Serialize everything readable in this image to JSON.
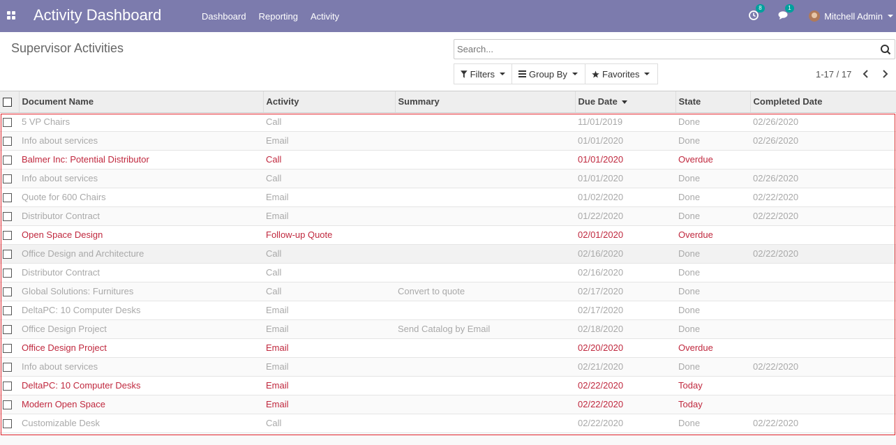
{
  "navbar": {
    "app_title": "Activity Dashboard",
    "menu": [
      "Dashboard",
      "Reporting",
      "Activity"
    ],
    "activity_count": "8",
    "message_count": "1",
    "user_name": "Mitchell Admin",
    "bg_color": "#7c7bad"
  },
  "control": {
    "page_title": "Supervisor Activities",
    "search_placeholder": "Search...",
    "filters_label": "Filters",
    "group_by_label": "Group By",
    "favorites_label": "Favorites",
    "pager_value": "1-17 / 17"
  },
  "table": {
    "headers": [
      "Document Name",
      "Activity",
      "Summary",
      "Due Date",
      "State",
      "Completed Date"
    ],
    "sorted_column": "Due Date",
    "rows": [
      {
        "doc": "5 VP Chairs",
        "activity": "Call",
        "summary": "",
        "due": "11/01/2019",
        "state": "Done",
        "completed": "02/26/2020"
      },
      {
        "doc": "Info about services",
        "activity": "Email",
        "summary": "",
        "due": "01/01/2020",
        "state": "Done",
        "completed": "02/26/2020"
      },
      {
        "doc": "Balmer Inc: Potential Distributor",
        "activity": "Call",
        "summary": "",
        "due": "01/01/2020",
        "state": "Overdue",
        "completed": ""
      },
      {
        "doc": "Info about services",
        "activity": "Call",
        "summary": "",
        "due": "01/01/2020",
        "state": "Done",
        "completed": "02/26/2020"
      },
      {
        "doc": "Quote for 600 Chairs",
        "activity": "Email",
        "summary": "",
        "due": "01/02/2020",
        "state": "Done",
        "completed": "02/22/2020"
      },
      {
        "doc": "Distributor Contract",
        "activity": "Email",
        "summary": "",
        "due": "01/22/2020",
        "state": "Done",
        "completed": "02/22/2020"
      },
      {
        "doc": "Open Space Design",
        "activity": "Follow-up Quote",
        "summary": "",
        "due": "02/01/2020",
        "state": "Overdue",
        "completed": ""
      },
      {
        "doc": "Office Design and Architecture",
        "activity": "Call",
        "summary": "",
        "due": "02/16/2020",
        "state": "Done",
        "completed": "02/22/2020"
      },
      {
        "doc": "Distributor Contract",
        "activity": "Call",
        "summary": "",
        "due": "02/16/2020",
        "state": "Done",
        "completed": ""
      },
      {
        "doc": "Global Solutions: Furnitures",
        "activity": "Call",
        "summary": "Convert to quote",
        "due": "02/17/2020",
        "state": "Done",
        "completed": ""
      },
      {
        "doc": "DeltaPC: 10 Computer Desks",
        "activity": "Email",
        "summary": "",
        "due": "02/17/2020",
        "state": "Done",
        "completed": ""
      },
      {
        "doc": "Office Design Project",
        "activity": "Email",
        "summary": "Send Catalog by Email",
        "due": "02/18/2020",
        "state": "Done",
        "completed": ""
      },
      {
        "doc": "Office Design Project",
        "activity": "Email",
        "summary": "",
        "due": "02/20/2020",
        "state": "Overdue",
        "completed": ""
      },
      {
        "doc": "Info about services",
        "activity": "Email",
        "summary": "",
        "due": "02/21/2020",
        "state": "Done",
        "completed": "02/22/2020"
      },
      {
        "doc": "DeltaPC: 10 Computer Desks",
        "activity": "Email",
        "summary": "",
        "due": "02/22/2020",
        "state": "Today",
        "completed": ""
      },
      {
        "doc": "Modern Open Space",
        "activity": "Email",
        "summary": "",
        "due": "02/22/2020",
        "state": "Today",
        "completed": ""
      },
      {
        "doc": "Customizable Desk",
        "activity": "Call",
        "summary": "",
        "due": "02/22/2020",
        "state": "Done",
        "completed": "02/22/2020"
      }
    ],
    "done_color": "#a9a9a9",
    "overdue_color": "#c0283e",
    "selection_outline_color": "#e0242c"
  }
}
